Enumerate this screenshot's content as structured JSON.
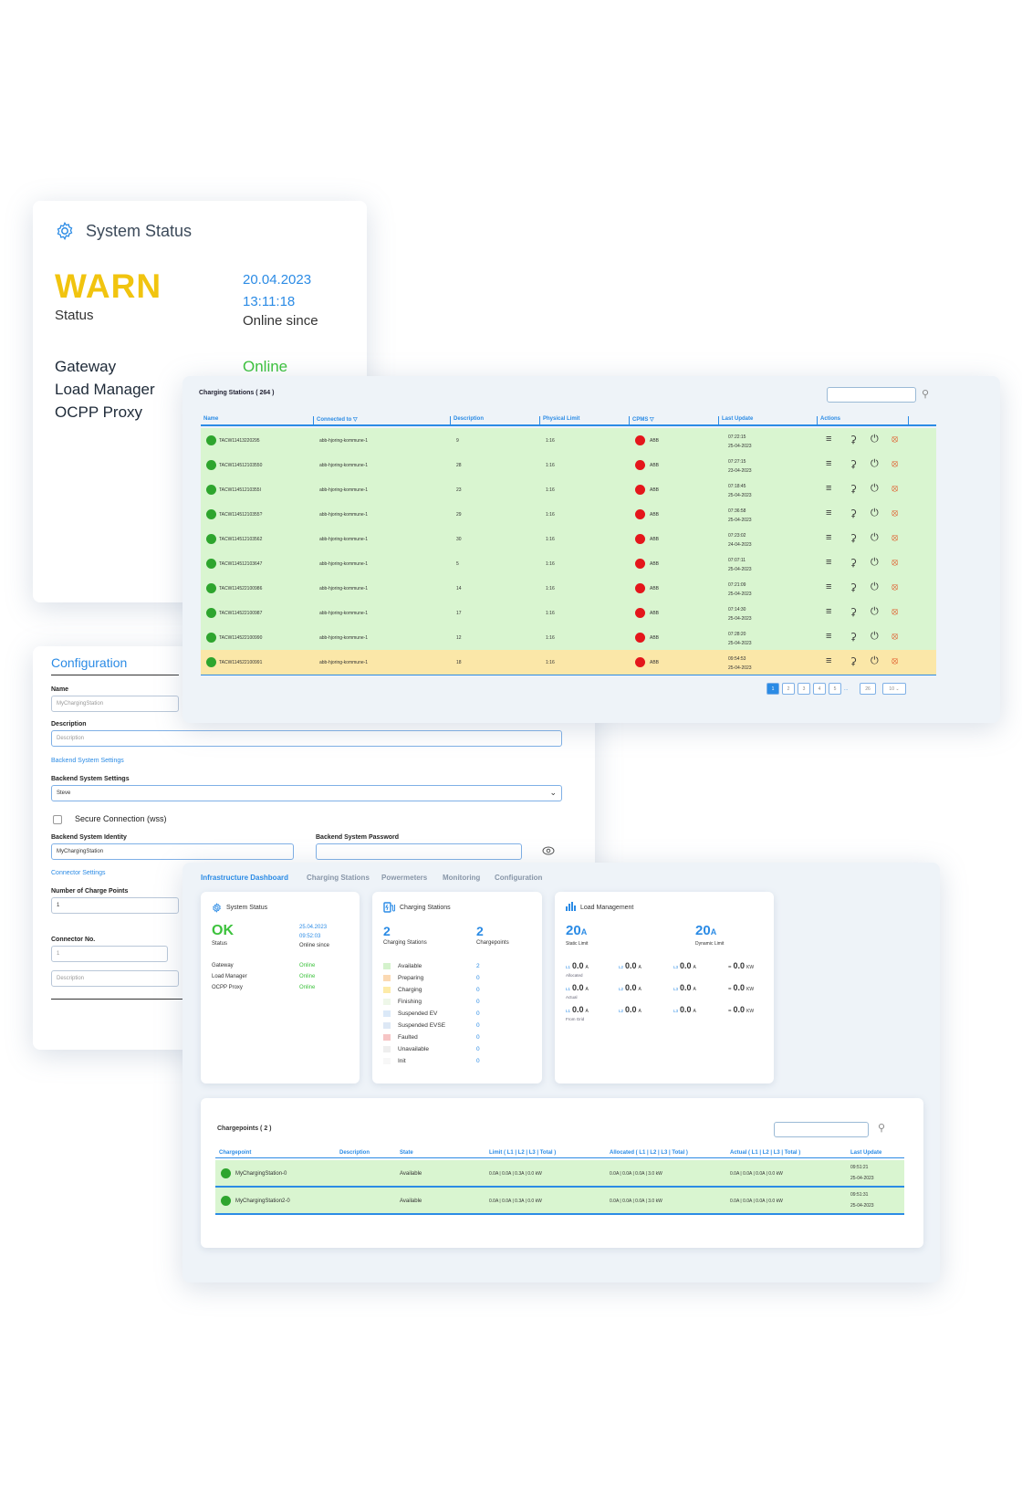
{
  "system_status_card": {
    "title": "System Status",
    "status": "WARN",
    "status_label": "Status",
    "date": "20.04.2023",
    "time": "13:11:18",
    "online_since": "Online since",
    "services": [
      "Gateway",
      "Load Manager",
      "OCPP Proxy"
    ],
    "online": "Online"
  },
  "configuration": {
    "title": "Configuration",
    "name_label": "Name",
    "name_placeholder": "MyChargingStation",
    "description_label": "Description",
    "description_placeholder": "Description",
    "backend_section": "Backend System Settings",
    "backend_label": "Backend System Settings",
    "backend_value": "Steve",
    "secure_label": "Secure Connection (wss)",
    "identity_label": "Backend System Identity",
    "identity_value": "MyChargingStation",
    "password_label": "Backend System Password",
    "connector_section": "Connector Settings",
    "charge_points_label": "Number of Charge Points",
    "charge_points_value": "1",
    "connector_no_label": "Connector No.",
    "connector_no_value": "1",
    "connector_desc_placeholder": "Description"
  },
  "stations_table": {
    "title": "Charging Stations ( 264 )",
    "headers": [
      "Name",
      "Connected to ▽",
      "Description",
      "Physical Limit",
      "CPMS ▽",
      "Last Update",
      "Actions"
    ],
    "rows": [
      {
        "name": "TACW11413220295",
        "conn": "abb-hjoring-kommune-1",
        "desc": "9",
        "limit": "1:16",
        "cpms": "ABB",
        "time": "07:22:15",
        "date": "25-04-2023",
        "state": "ok"
      },
      {
        "name": "TACW114512103550",
        "conn": "abb-hjoring-kommune-1",
        "desc": "28",
        "limit": "1:16",
        "cpms": "ABB",
        "time": "07:27:15",
        "date": "23-04-2023",
        "state": "ok"
      },
      {
        "name": "TACW11451210355I",
        "conn": "abb-hjoring-kommune-1",
        "desc": "23",
        "limit": "1:16",
        "cpms": "ABB",
        "time": "07:18:45",
        "date": "25-04-2023",
        "state": "ok"
      },
      {
        "name": "TACW11451210355?",
        "conn": "abb-hjoring-kommune-1",
        "desc": "29",
        "limit": "1:16",
        "cpms": "ABB",
        "time": "07:36:58",
        "date": "25-04-2023",
        "state": "ok"
      },
      {
        "name": "TACW114512103562",
        "conn": "abb-hjoring-kommune-1",
        "desc": "30",
        "limit": "1:16",
        "cpms": "ABB",
        "time": "07:23:02",
        "date": "24-04-2023",
        "state": "ok"
      },
      {
        "name": "TACW114512103647",
        "conn": "abb-hjoring-kommune-1",
        "desc": "5",
        "limit": "1:16",
        "cpms": "ABB",
        "time": "07:07:11",
        "date": "25-04-2023",
        "state": "ok"
      },
      {
        "name": "TACW114522100986",
        "conn": "abb-hjoring-kommune-1",
        "desc": "14",
        "limit": "1:16",
        "cpms": "ABB",
        "time": "07:21:09",
        "date": "25-04-2023",
        "state": "ok"
      },
      {
        "name": "TACW114522100987",
        "conn": "abb-hjoring-kommune-1",
        "desc": "17",
        "limit": "1:16",
        "cpms": "ABB",
        "time": "07:14:30",
        "date": "25-04-2023",
        "state": "ok"
      },
      {
        "name": "TACW114522100990",
        "conn": "abb-hjoring-kommune-1",
        "desc": "12",
        "limit": "1:16",
        "cpms": "ABB",
        "time": "07:28:20",
        "date": "25-04-2023",
        "state": "ok"
      },
      {
        "name": "TACW114522100991",
        "conn": "abb-hjoring-kommune-1",
        "desc": "18",
        "limit": "1:16",
        "cpms": "ABB",
        "time": "09:54:53",
        "date": "25-04-2023",
        "state": "warn"
      }
    ],
    "pages": [
      "1",
      "2",
      "3",
      "4",
      "5",
      "...",
      "26"
    ],
    "page_size": "10 ⌄"
  },
  "dashboard": {
    "tabs": [
      "Infrastructure Dashboard",
      "Charging Stations",
      "Powermeters",
      "Monitoring",
      "Configuration"
    ],
    "system_status": {
      "title": "System Status",
      "status": "OK",
      "status_label": "Status",
      "date": "25.04.2023",
      "time": "09:52:03",
      "online_since": "Online since",
      "services": [
        "Gateway",
        "Load Manager",
        "OCPP Proxy"
      ],
      "online": "Online"
    },
    "charging_stations": {
      "title": "Charging Stations",
      "stations_count": "2",
      "stations_label": "Charging Stations",
      "chargepoints_count": "2",
      "chargepoints_label": "Chargepoints",
      "states": [
        {
          "label": "Available",
          "count": "2",
          "color": "#d4f2cc"
        },
        {
          "label": "Preparing",
          "count": "0",
          "color": "#fbd9b3"
        },
        {
          "label": "Charging",
          "count": "0",
          "color": "#fdeba8"
        },
        {
          "label": "Finishing",
          "count": "0",
          "color": "#eef7e9"
        },
        {
          "label": "Suspended EV",
          "count": "0",
          "color": "#dbe9f8"
        },
        {
          "label": "Suspended EVSE",
          "count": "0",
          "color": "#dde8f5"
        },
        {
          "label": "Faulted",
          "count": "0",
          "color": "#f6c5c5"
        },
        {
          "label": "Unavailable",
          "count": "0",
          "color": "#eeeeee"
        },
        {
          "label": "Init",
          "count": "0",
          "color": "#f7f7f7"
        }
      ]
    },
    "load_management": {
      "title": "Load Management",
      "static_value": "20",
      "static_unit": "A",
      "static_label": "Static Limit",
      "dynamic_value": "20",
      "dynamic_unit": "A",
      "dynamic_label": "Dynamic Limit",
      "rows": [
        {
          "label": "Allocated",
          "l1": "0.0",
          "l2": "0.0",
          "l3": "0.0",
          "total": "0.0"
        },
        {
          "label": "Actual",
          "l1": "0.0",
          "l2": "0.0",
          "l3": "0.0",
          "total": "0.0"
        },
        {
          "label": "From Grid",
          "l1": "0.0",
          "l2": "0.0",
          "l3": "0.0",
          "total": "0.0"
        }
      ],
      "l1": "L1",
      "l2": "L2",
      "l3": "L3",
      "amp": "A",
      "eq": "=",
      "kw": "KW"
    },
    "chargepoints": {
      "title": "Chargepoints ( 2 )",
      "headers": [
        "Chargepoint",
        "Description",
        "State",
        "Limit ( L1 | L2 | L3 | Total )",
        "Allocated ( L1 | L2 | L3 | Total )",
        "Actual ( L1 | L2 | L3 | Total )",
        "Last Update"
      ],
      "rows": [
        {
          "name": "MyChargingStation-0",
          "state": "Available",
          "limit": "0.0A | 0.0A | 0.3A | 0.0 kW",
          "alloc": "0.0A | 0.0A | 0.0A | 3.0 kW",
          "actual": "0.0A | 0.0A | 0.0A | 0.0 kW",
          "time": "09:51:21",
          "date": "25-04-2023"
        },
        {
          "name": "MyChargingStation2-0",
          "state": "Available",
          "limit": "0.0A | 0.0A | 0.3A | 0.0 kW",
          "alloc": "0.0A | 0.0A | 0.0A | 3.0 kW",
          "actual": "0.0A | 0.0A | 0.0A | 0.0 kW",
          "time": "09:51:31",
          "date": "25-04-2023"
        }
      ]
    }
  }
}
